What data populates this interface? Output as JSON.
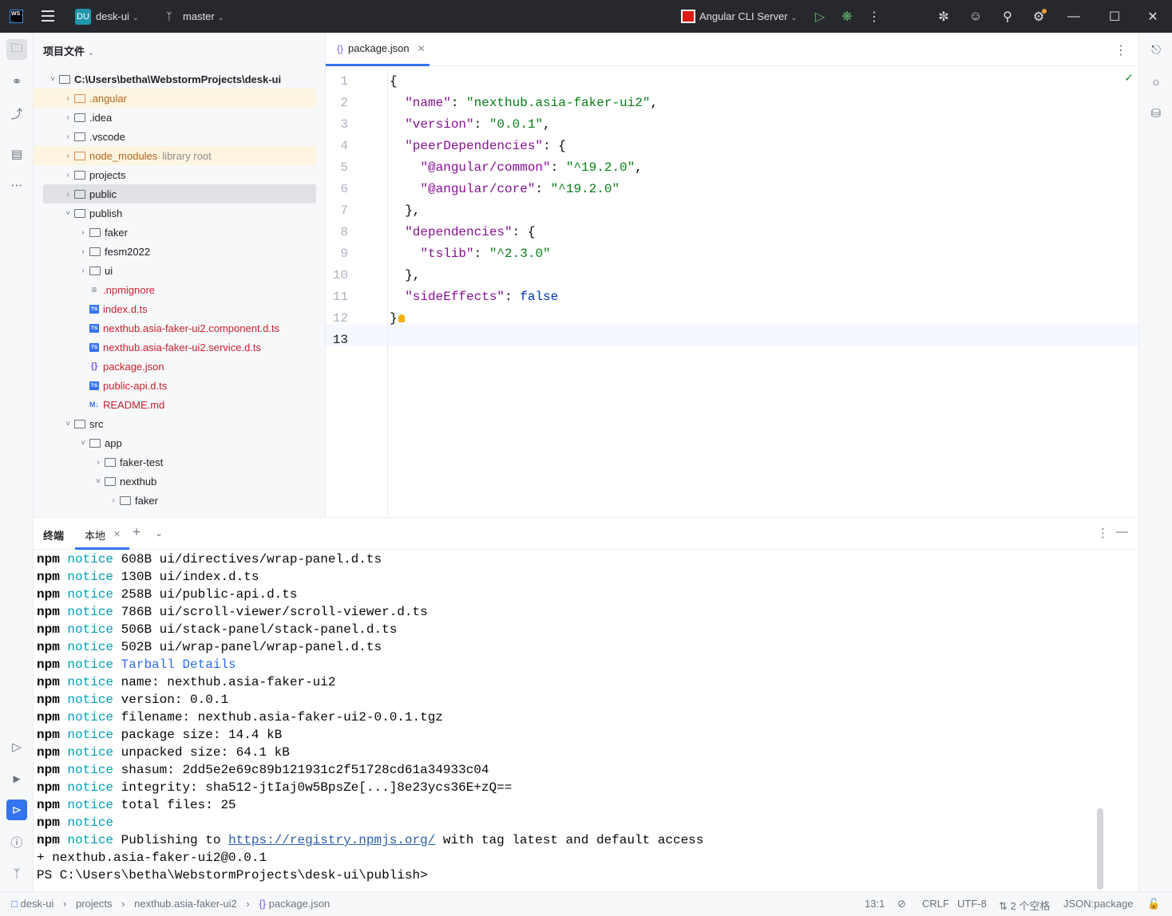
{
  "titlebar": {
    "project_badge": "DU",
    "project_name": "desk-ui",
    "branch": "master",
    "run_config": "Angular CLI Server"
  },
  "project_panel": {
    "title": "项目文件",
    "tree": [
      {
        "label": "C:\\Users\\betha\\WebstormProjects\\desk-ui",
        "depth": 0,
        "kind": "folder",
        "expanded": true
      },
      {
        "label": ".angular",
        "depth": 1,
        "kind": "folder-excluded"
      },
      {
        "label": ".idea",
        "depth": 1,
        "kind": "folder"
      },
      {
        "label": ".vscode",
        "depth": 1,
        "kind": "folder"
      },
      {
        "label": "node_modules",
        "suffix": "library root",
        "depth": 1,
        "kind": "folder-excluded"
      },
      {
        "label": "projects",
        "depth": 1,
        "kind": "folder"
      },
      {
        "label": "public",
        "depth": 1,
        "kind": "folder",
        "selected": true
      },
      {
        "label": "publish",
        "depth": 1,
        "kind": "folder",
        "expanded": true
      },
      {
        "label": "faker",
        "depth": 2,
        "kind": "folder"
      },
      {
        "label": "fesm2022",
        "depth": 2,
        "kind": "folder"
      },
      {
        "label": "ui",
        "depth": 2,
        "kind": "folder"
      },
      {
        "label": ".npmignore",
        "depth": 2,
        "kind": "file-text"
      },
      {
        "label": "index.d.ts",
        "depth": 2,
        "kind": "file-ts"
      },
      {
        "label": "nexthub.asia-faker-ui2.component.d.ts",
        "depth": 2,
        "kind": "file-ts"
      },
      {
        "label": "nexthub.asia-faker-ui2.service.d.ts",
        "depth": 2,
        "kind": "file-ts"
      },
      {
        "label": "package.json",
        "depth": 2,
        "kind": "file-json"
      },
      {
        "label": "public-api.d.ts",
        "depth": 2,
        "kind": "file-ts"
      },
      {
        "label": "README.md",
        "depth": 2,
        "kind": "file-md"
      },
      {
        "label": "src",
        "depth": 1,
        "kind": "folder",
        "expanded": true
      },
      {
        "label": "app",
        "depth": 2,
        "kind": "folder",
        "expanded": true
      },
      {
        "label": "faker-test",
        "depth": 3,
        "kind": "folder"
      },
      {
        "label": "nexthub",
        "depth": 3,
        "kind": "folder",
        "expanded": true
      },
      {
        "label": "faker",
        "depth": 4,
        "kind": "folder"
      }
    ]
  },
  "editor": {
    "tab_label": "package.json",
    "line_numbers": [
      "1",
      "2",
      "3",
      "4",
      "5",
      "6",
      "7",
      "8",
      "9",
      "10",
      "11",
      "12",
      "13"
    ],
    "lines": [
      [
        [
          "p",
          "{"
        ]
      ],
      [
        [
          "p",
          "  "
        ],
        [
          "k",
          "\"name\""
        ],
        [
          "p",
          ": "
        ],
        [
          "s",
          "\"nexthub.asia-faker-ui2\""
        ],
        [
          "p",
          ","
        ]
      ],
      [
        [
          "p",
          "  "
        ],
        [
          "k",
          "\"version\""
        ],
        [
          "p",
          ": "
        ],
        [
          "s",
          "\"0.0.1\""
        ],
        [
          "p",
          ","
        ]
      ],
      [
        [
          "p",
          "  "
        ],
        [
          "k",
          "\"peerDependencies\""
        ],
        [
          "p",
          ": {"
        ]
      ],
      [
        [
          "p",
          "    "
        ],
        [
          "k",
          "\"@angular/common\""
        ],
        [
          "p",
          ": "
        ],
        [
          "s",
          "\"^19.2.0\""
        ],
        [
          "p",
          ","
        ]
      ],
      [
        [
          "p",
          "    "
        ],
        [
          "k",
          "\"@angular/core\""
        ],
        [
          "p",
          ": "
        ],
        [
          "s",
          "\"^19.2.0\""
        ]
      ],
      [
        [
          "p",
          "  },"
        ]
      ],
      [
        [
          "p",
          "  "
        ],
        [
          "k",
          "\"dependencies\""
        ],
        [
          "p",
          ": {"
        ]
      ],
      [
        [
          "p",
          "    "
        ],
        [
          "k",
          "\"tslib\""
        ],
        [
          "p",
          ": "
        ],
        [
          "s",
          "\"^2.3.0\""
        ]
      ],
      [
        [
          "p",
          "  },"
        ]
      ],
      [
        [
          "p",
          "  "
        ],
        [
          "k",
          "\"sideEffects\""
        ],
        [
          "p",
          ": "
        ],
        [
          "b",
          "false"
        ]
      ],
      [
        [
          "p",
          "}"
        ]
      ],
      [
        [
          "p",
          ""
        ]
      ]
    ]
  },
  "terminal": {
    "tab_group": "终端",
    "tab_local": "本地",
    "lines": [
      {
        "npm": "npm",
        "notice": "notice",
        "rest": " 608B ui/directives/wrap-panel.d.ts"
      },
      {
        "npm": "npm",
        "notice": "notice",
        "rest": " 130B ui/index.d.ts"
      },
      {
        "npm": "npm",
        "notice": "notice",
        "rest": " 258B ui/public-api.d.ts"
      },
      {
        "npm": "npm",
        "notice": "notice",
        "rest": " 786B ui/scroll-viewer/scroll-viewer.d.ts"
      },
      {
        "npm": "npm",
        "notice": "notice",
        "rest": " 506B ui/stack-panel/stack-panel.d.ts"
      },
      {
        "npm": "npm",
        "notice": "notice",
        "rest": " 502B ui/wrap-panel/wrap-panel.d.ts"
      },
      {
        "npm": "npm",
        "notice": "notice",
        "highlight": " Tarball Details"
      },
      {
        "npm": "npm",
        "notice": "notice",
        "rest": " name: nexthub.asia-faker-ui2"
      },
      {
        "npm": "npm",
        "notice": "notice",
        "rest": " version: 0.0.1"
      },
      {
        "npm": "npm",
        "notice": "notice",
        "rest": " filename: nexthub.asia-faker-ui2-0.0.1.tgz"
      },
      {
        "npm": "npm",
        "notice": "notice",
        "rest": " package size: 14.4 kB"
      },
      {
        "npm": "npm",
        "notice": "notice",
        "rest": " unpacked size: 64.1 kB"
      },
      {
        "npm": "npm",
        "notice": "notice",
        "rest": " shasum: 2dd5e2e69c89b121931c2f51728cd61a34933c04"
      },
      {
        "npm": "npm",
        "notice": "notice",
        "rest": " integrity: sha512-jtIaj0w5BpsZe[...]8e23ycs36E+zQ=="
      },
      {
        "npm": "npm",
        "notice": "notice",
        "rest": " total files: 25"
      },
      {
        "npm": "npm",
        "notice": "notice",
        "rest": ""
      },
      {
        "npm": "npm",
        "notice": "notice",
        "rest": " Publishing to ",
        "link": "https://registry.npmjs.org/",
        "after": " with tag latest and default access"
      },
      {
        "plain": "+ nexthub.asia-faker-ui2@0.0.1"
      },
      {
        "plain": "PS C:\\Users\\betha\\WebstormProjects\\desk-ui\\publish>"
      }
    ]
  },
  "statusbar": {
    "crumb_project": "desk-ui",
    "crumb_1": "projects",
    "crumb_2": "nexthub.asia-faker-ui2",
    "crumb_file": "package.json",
    "position": "13:1",
    "line_sep": "CRLF",
    "encoding": "UTF-8",
    "indent": "2 个空格",
    "schema": "JSON:package"
  },
  "colors": {
    "accent": "#3574f0",
    "titlebar_bg": "#27282e",
    "json_key": "#871094",
    "json_string": "#067d17",
    "npm_notice": "#00a0b4"
  }
}
